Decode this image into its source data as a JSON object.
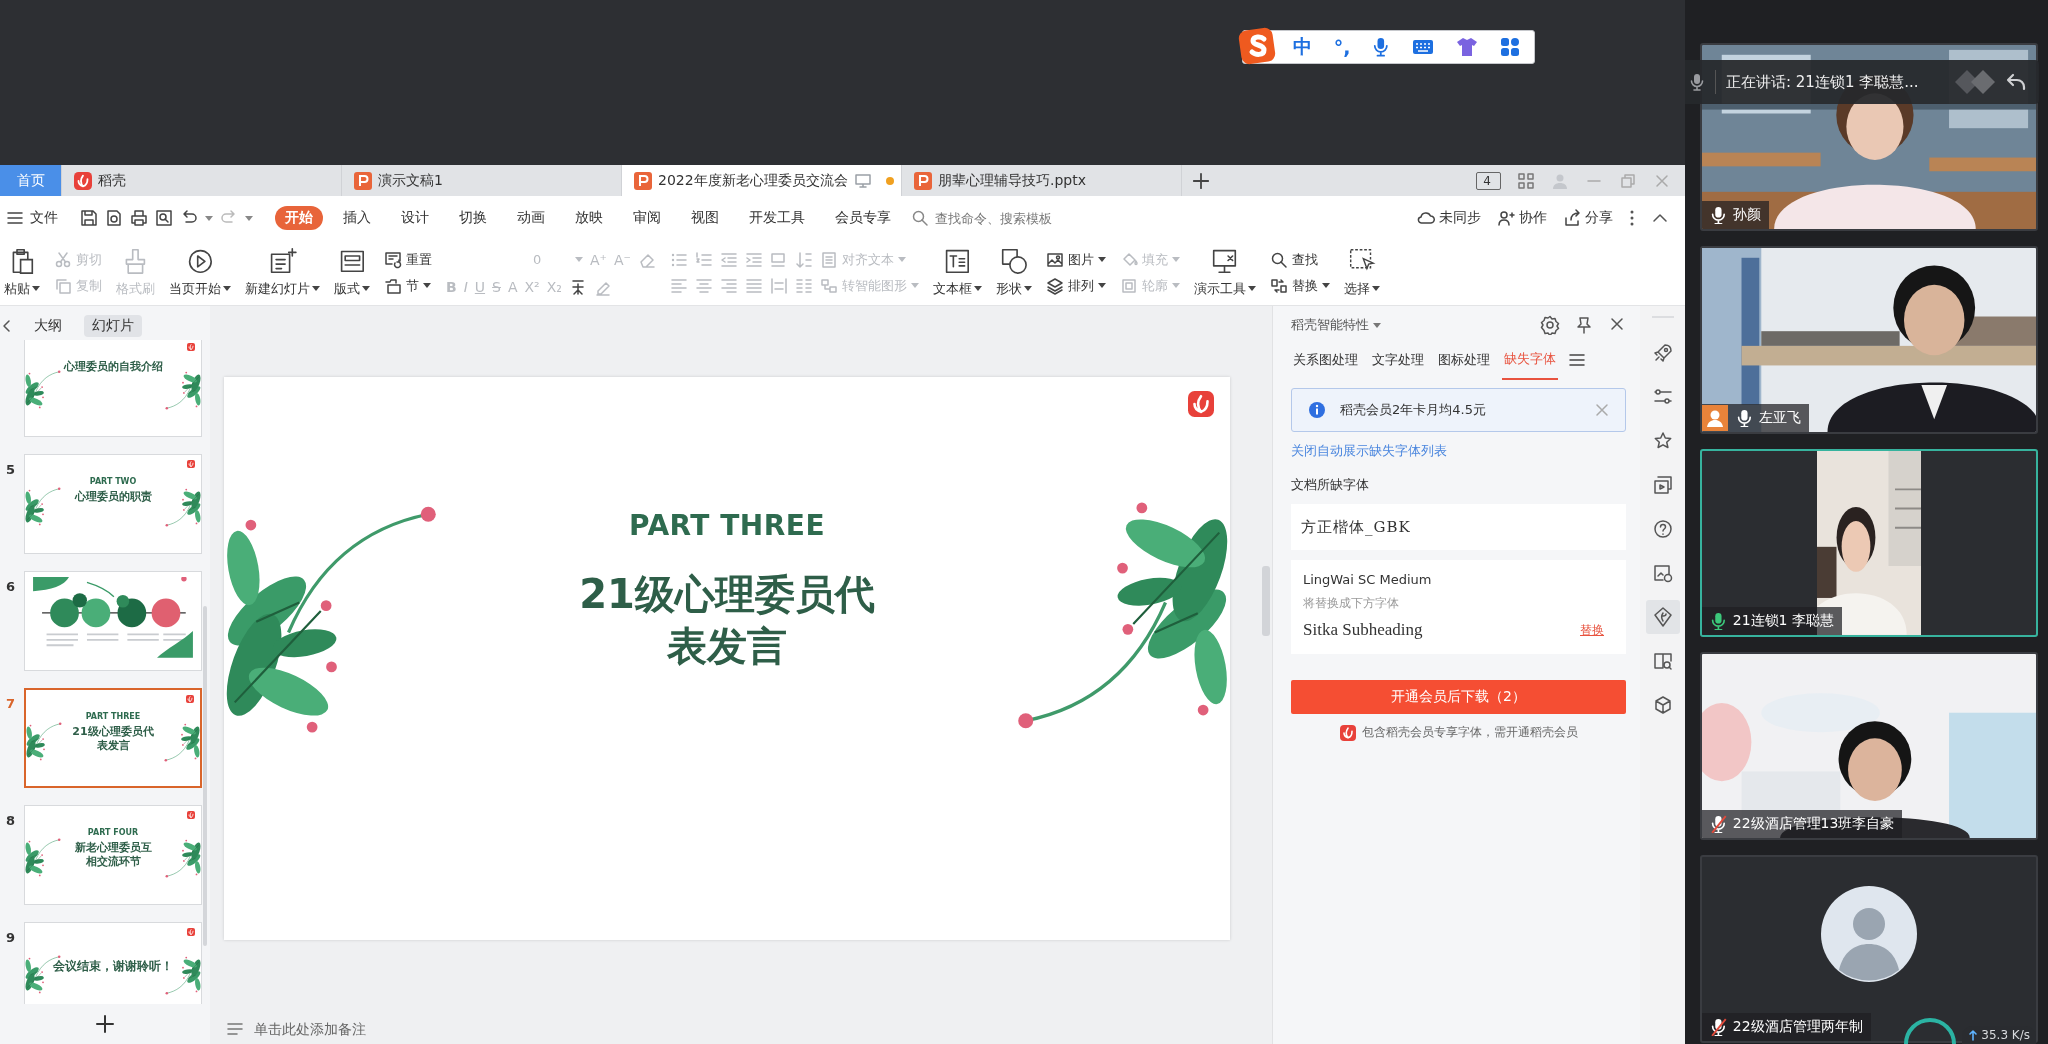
{
  "ime_bar": {
    "language": "中",
    "punctuation": "°,"
  },
  "tabs": [
    {
      "kind": "home",
      "label": "首页",
      "selected": false
    },
    {
      "kind": "docer",
      "label": "稻壳",
      "selected": false
    },
    {
      "kind": "presentation",
      "label": "演示文稿1",
      "selected": false
    },
    {
      "kind": "presentation",
      "label": "2022年度新老心理委员交流会",
      "selected": true
    },
    {
      "kind": "presentation",
      "label": "朋辈心理辅导技巧.pptx",
      "selected": false
    }
  ],
  "window_badge": "4",
  "file_menu": "文件",
  "ribbon_tabs": [
    {
      "label": "开始",
      "selected": true
    },
    {
      "label": "插入",
      "selected": false
    },
    {
      "label": "设计",
      "selected": false
    },
    {
      "label": "切换",
      "selected": false
    },
    {
      "label": "动画",
      "selected": false
    },
    {
      "label": "放映",
      "selected": false
    },
    {
      "label": "审阅",
      "selected": false
    },
    {
      "label": "视图",
      "selected": false
    },
    {
      "label": "开发工具",
      "selected": false
    },
    {
      "label": "会员专享",
      "selected": false
    }
  ],
  "command_search": {
    "placeholder": "查找命令、搜索模板"
  },
  "header_actions": [
    "未同步",
    "协作",
    "分享"
  ],
  "ribbon": [
    {
      "kind": "large",
      "label": "粘贴",
      "dropdown": true,
      "disabled": false
    },
    {
      "kind": "stack",
      "items": [
        {
          "label": "剪切",
          "dropdown": false,
          "disabled": true
        },
        {
          "label": "复制",
          "dropdown": false,
          "disabled": true
        }
      ]
    },
    {
      "kind": "large",
      "label": "格式刷",
      "dropdown": false,
      "disabled": true
    },
    {
      "kind": "large",
      "label": "当页开始",
      "dropdown": true,
      "disabled": false
    },
    {
      "kind": "large",
      "label": "新建幻灯片",
      "dropdown": true,
      "disabled": false
    },
    {
      "kind": "large",
      "label": "版式",
      "dropdown": true,
      "disabled": false
    },
    {
      "kind": "stack",
      "items": [
        {
          "label": "重置",
          "dropdown": false,
          "disabled": false
        },
        {
          "label": "节",
          "dropdown": true,
          "disabled": false
        }
      ]
    },
    {
      "kind": "font",
      "size": "0",
      "top_glyphs": [
        "A⁺",
        "A⁻"
      ],
      "styles": [
        "B",
        "I",
        "U",
        "S",
        "A",
        "X²",
        "X₂"
      ],
      "disabled": true
    },
    {
      "kind": "paragraph",
      "items": [
        {
          "label": "对齐文本",
          "dropdown": true,
          "disabled": true
        },
        {
          "label": "转智能图形",
          "dropdown": true,
          "disabled": true
        }
      ]
    },
    {
      "kind": "large",
      "label": "文本框",
      "dropdown": true,
      "disabled": false
    },
    {
      "kind": "large",
      "label": "形状",
      "dropdown": true,
      "disabled": false
    },
    {
      "kind": "stack",
      "items": [
        {
          "label": "图片",
          "dropdown": true,
          "disabled": false
        },
        {
          "label": "排列",
          "dropdown": true,
          "disabled": false
        }
      ]
    },
    {
      "kind": "stack",
      "items": [
        {
          "label": "填充",
          "dropdown": true,
          "disabled": true
        },
        {
          "label": "轮廓",
          "dropdown": true,
          "disabled": true
        }
      ]
    },
    {
      "kind": "large",
      "label": "演示工具",
      "dropdown": true,
      "disabled": false
    },
    {
      "kind": "stack",
      "items": [
        {
          "label": "查找",
          "dropdown": false,
          "disabled": false
        },
        {
          "label": "替换",
          "dropdown": true,
          "disabled": false
        }
      ]
    },
    {
      "kind": "large",
      "label": "选择",
      "dropdown": true,
      "disabled": false
    }
  ],
  "slide_panel": {
    "tabs": [
      {
        "label": "大纲",
        "selected": false
      },
      {
        "label": "幻灯片",
        "selected": true
      }
    ],
    "slides": [
      {
        "kind": "section",
        "selected": false,
        "title_lines": [
          "心理委员的自我介绍"
        ]
      },
      {
        "kind": "section",
        "number": "5",
        "selected": false,
        "part": "PART TWO",
        "title_lines": [
          "心理委员的职责"
        ]
      },
      {
        "kind": "timeline",
        "number": "6",
        "selected": false
      },
      {
        "kind": "section",
        "number": "7",
        "selected": true,
        "part": "PART THREE",
        "title_lines": [
          "21级心理委员代",
          "表发言"
        ]
      },
      {
        "kind": "section",
        "number": "8",
        "selected": false,
        "part": "PART FOUR",
        "title_lines": [
          "新老心理委员互",
          "相交流环节"
        ]
      },
      {
        "kind": "closing",
        "number": "9",
        "selected": false,
        "title_lines": [
          "会议结束，谢谢聆听！"
        ]
      }
    ]
  },
  "slide": {
    "part": "PART THREE",
    "title_lines": [
      "21级心理委员代",
      "表发言"
    ]
  },
  "notes": {
    "placeholder": "单击此处添加备注"
  },
  "side_panel": {
    "title": "稻壳智能特性",
    "tabs": [
      {
        "label": "关系图处理",
        "selected": false
      },
      {
        "label": "文字处理",
        "selected": false
      },
      {
        "label": "图标处理",
        "selected": false
      },
      {
        "label": "缺失字体",
        "selected": true
      }
    ],
    "notice": "稻壳会员2年卡月均4.5元",
    "link": "关闭自动展示缺失字体列表",
    "section_label": "文档所缺字体",
    "fonts": [
      {
        "kind": "plain",
        "name": "方正楷体_GBK"
      },
      {
        "kind": "replace",
        "name": "LingWai SC Medium",
        "hint": "将替换成下方字体",
        "replacement": "Sitka Subheading",
        "action": "替换"
      }
    ],
    "download_button": "开通会员后下载（2）",
    "footnote": "包含稻壳会员专享字体，需开通稻壳会员"
  },
  "side_strip": [
    {
      "selected": false
    },
    {
      "selected": false
    },
    {
      "selected": false
    },
    {
      "selected": false
    },
    {
      "selected": false
    },
    {
      "selected": false
    },
    {
      "selected": true
    },
    {
      "selected": false
    },
    {
      "selected": false
    }
  ],
  "meeting": {
    "speaking_banner": "正在讲话: 21连锁1 李聪慧...",
    "participants": [
      {
        "kind": "video",
        "name": "孙颜",
        "muted": false,
        "speaking": false,
        "active": false,
        "role_badge": false
      },
      {
        "kind": "video",
        "name": "左亚飞",
        "muted": false,
        "speaking": false,
        "active": false,
        "role_badge": true
      },
      {
        "kind": "portrait",
        "name": "21连锁1 李聪慧",
        "muted": false,
        "speaking": true,
        "active": true,
        "role_badge": false
      },
      {
        "kind": "video",
        "name": "22级酒店管理13班李自豪",
        "muted": true,
        "speaking": false,
        "active": false,
        "role_badge": false
      },
      {
        "kind": "avatar",
        "name": "22级酒店管理两年制",
        "muted": true,
        "speaking": false,
        "active": false,
        "role_badge": false
      }
    ],
    "upload_speed": "35.3 K/s"
  }
}
